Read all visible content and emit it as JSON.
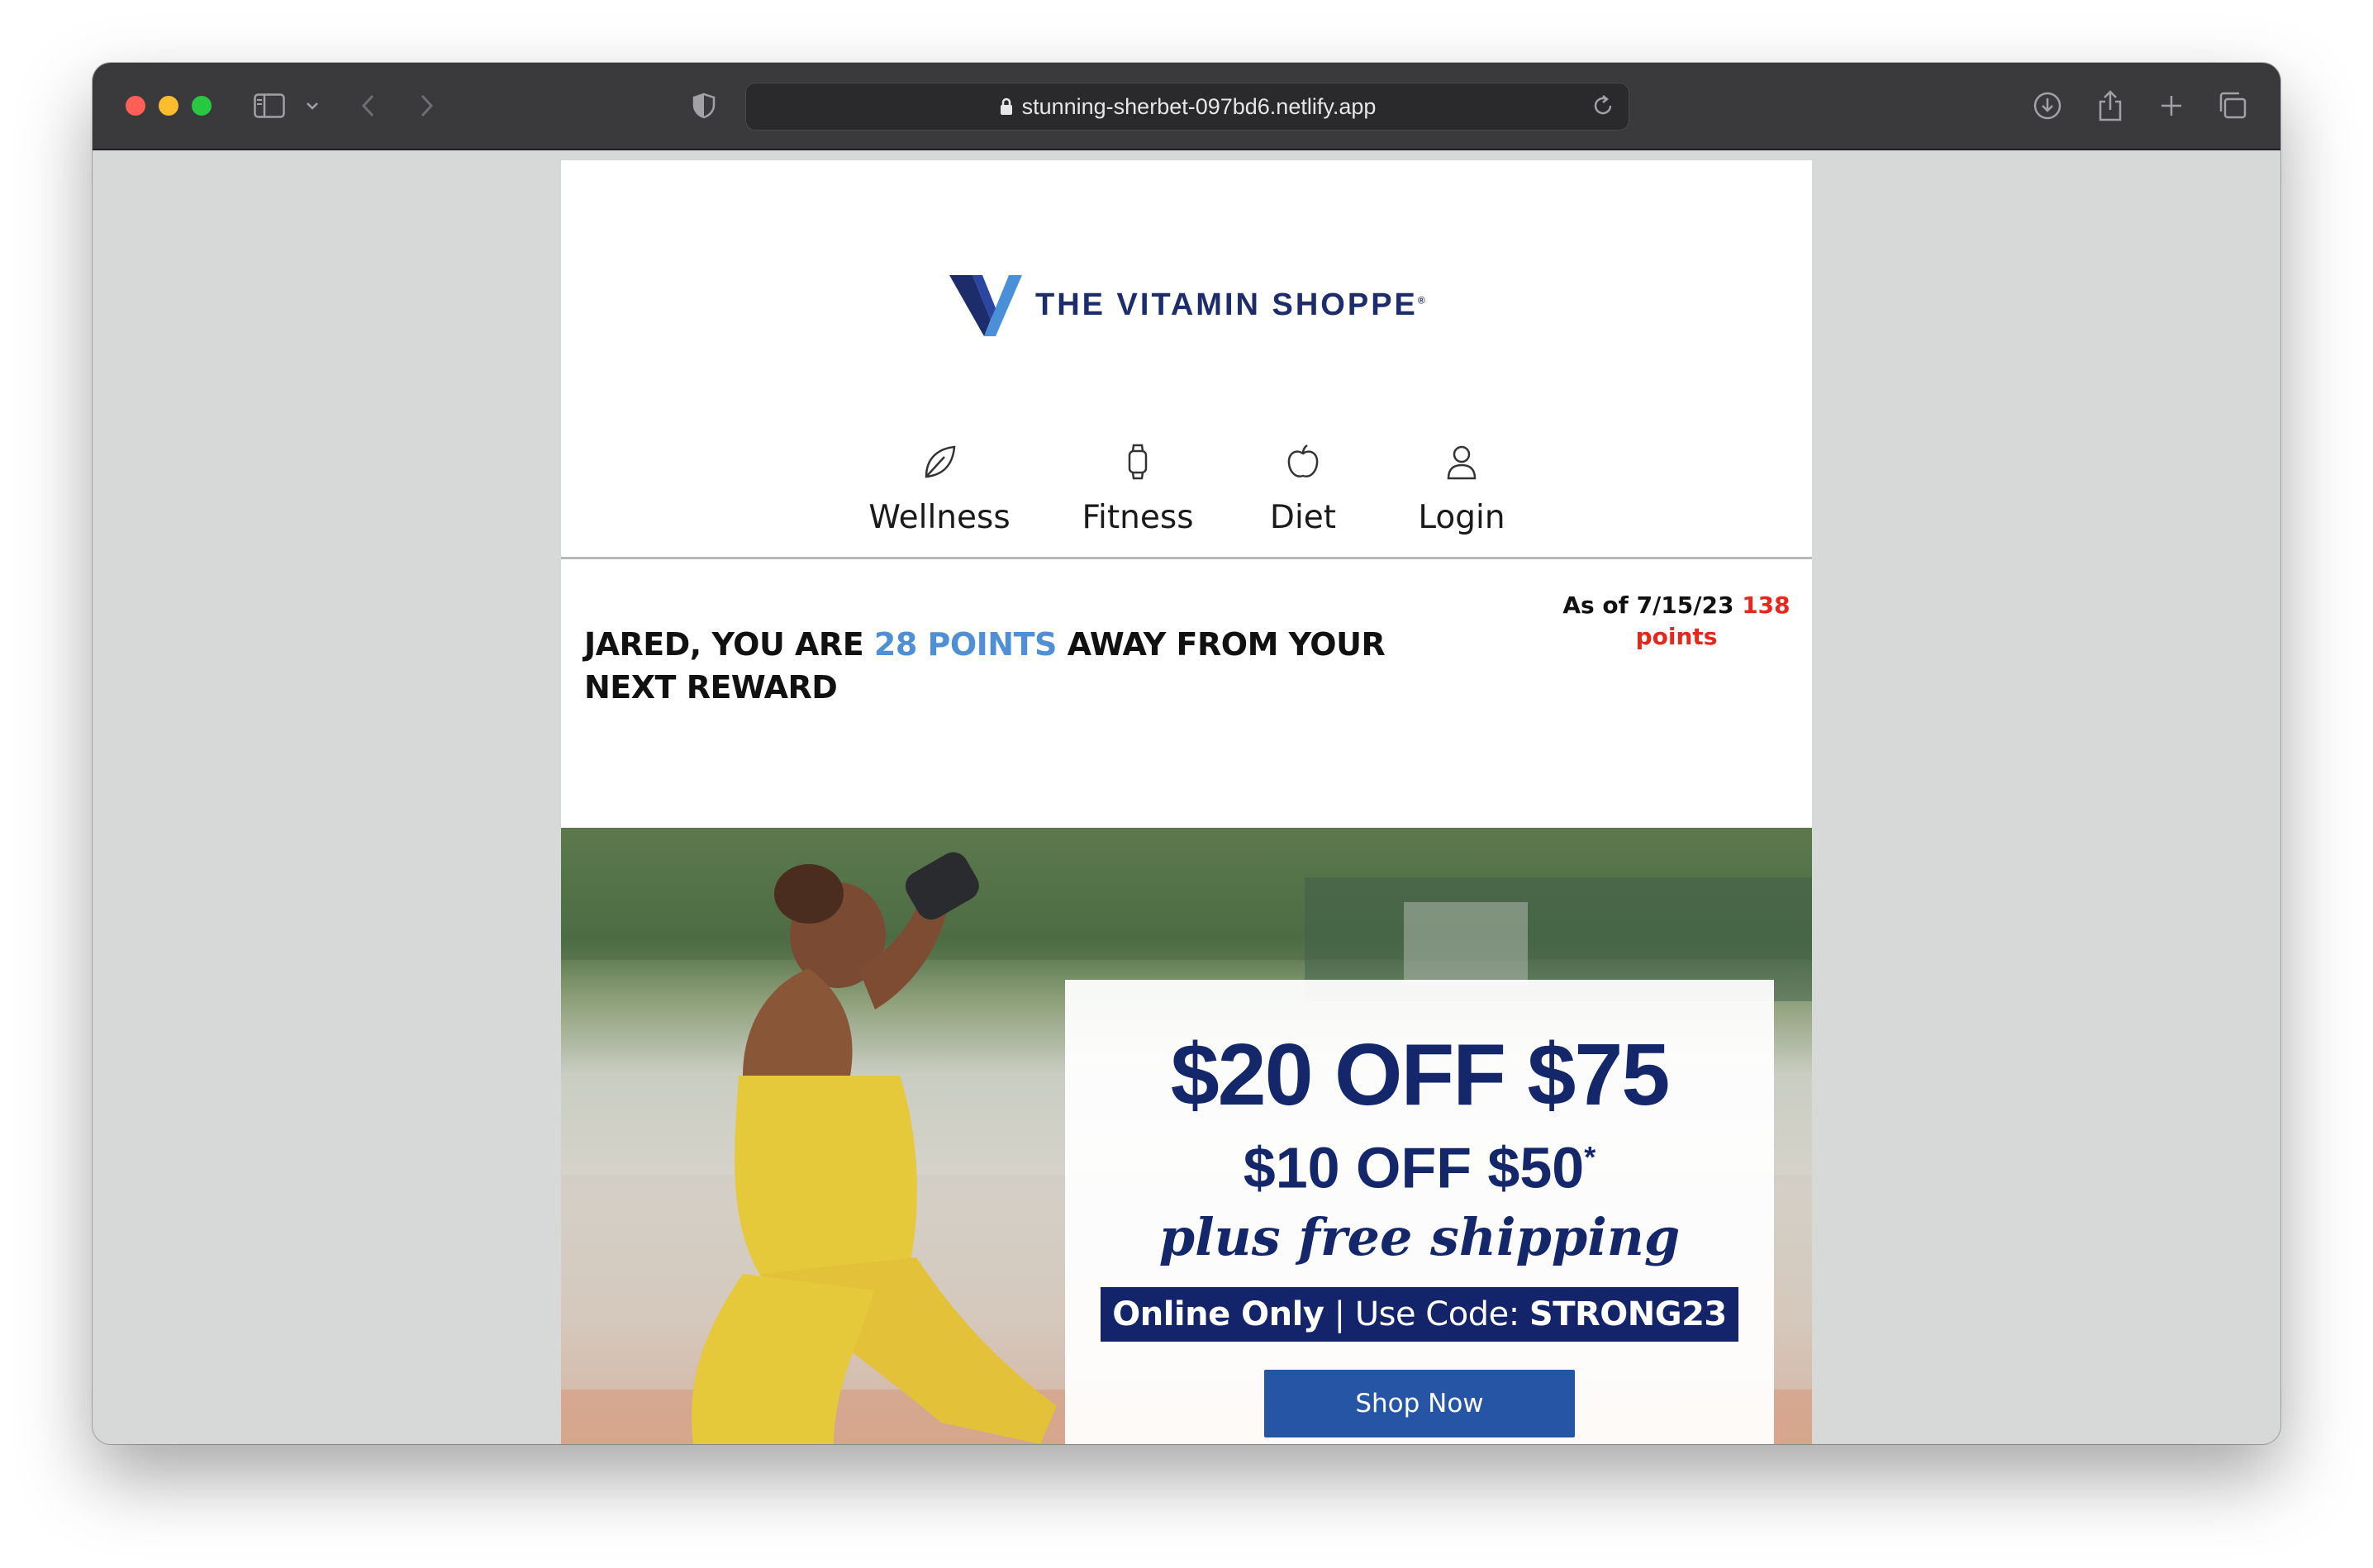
{
  "browser": {
    "url": "stunning-sherbet-097bd6.netlify.app"
  },
  "brand": {
    "name": "THE VITAMIN SHOPPE",
    "registered": "®",
    "navy": "#1d2d6b",
    "light_blue": "#4e8fd6"
  },
  "nav": {
    "items": [
      {
        "label": "Wellness",
        "icon": "leaf-icon"
      },
      {
        "label": "Fitness",
        "icon": "smartwatch-icon"
      },
      {
        "label": "Diet",
        "icon": "apple-icon"
      },
      {
        "label": "Login",
        "icon": "user-icon"
      }
    ]
  },
  "rewards": {
    "prefix": "JARED, YOU ARE",
    "highlight": "28 POINTS",
    "suffix": "AWAY FROM YOUR NEXT REWARD",
    "as_of": "As of 7/15/23",
    "points_value": "138",
    "points_unit": "points"
  },
  "promo": {
    "headline": "$20 OFF $75",
    "subheadline": "$10 OFF $50",
    "asterisk": "*",
    "script": "plus free shipping",
    "code_prefix": "Online Only",
    "code_separator": " | Use Code: ",
    "code": "STRONG23",
    "cta": "Shop Now"
  }
}
